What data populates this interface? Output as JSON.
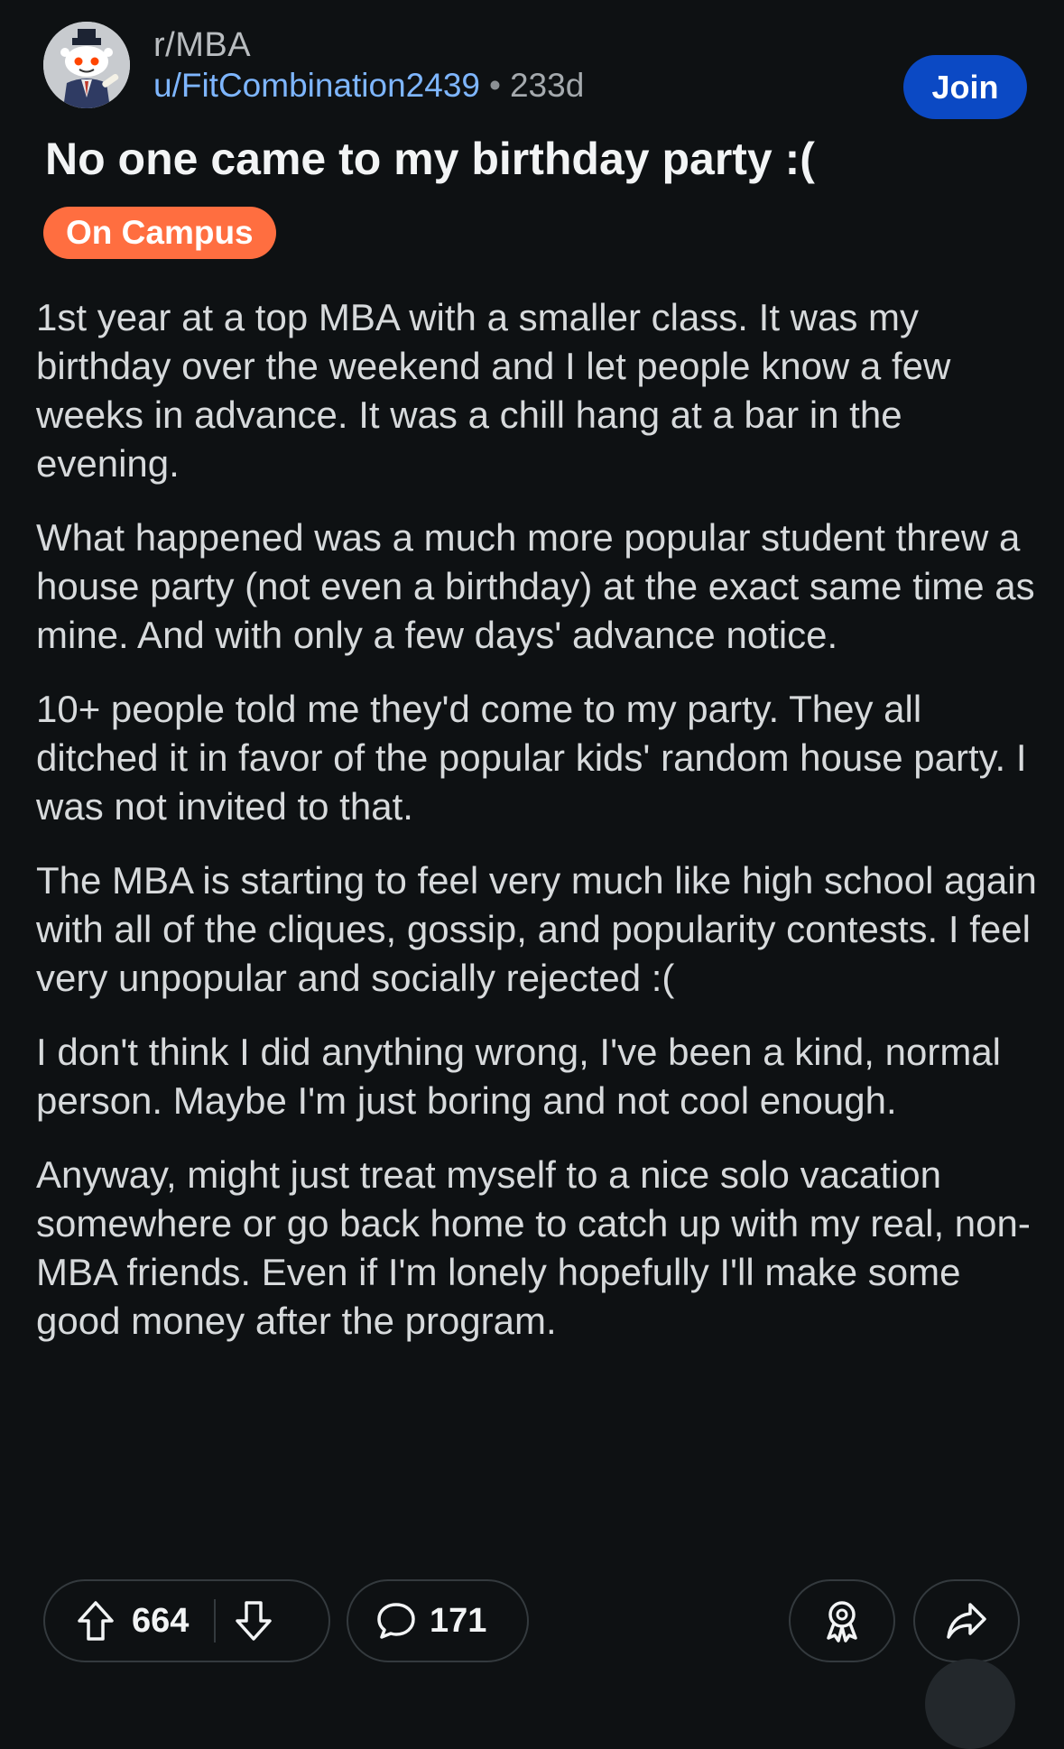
{
  "post": {
    "subreddit": "r/MBA",
    "username": "u/FitCombination2439",
    "separator": "•",
    "age": "233d",
    "join_label": "Join",
    "title": "No one came to my birthday party :(",
    "flair": "On Campus",
    "flair_color": "#ff6e40",
    "paragraphs": [
      "1st year at a top MBA with a smaller class. It was my birthday over the weekend and I let people know a few weeks in advance. It was a chill hang at a bar in the evening.",
      "What happened was a much more popular student threw a house party (not even a birthday) at the exact same time as mine. And with only a few days' advance notice.",
      "10+ people told me they'd come to my party. They all ditched it in favor of the popular kids' random house party. I was not invited to that.",
      "The MBA is starting to feel very much like high school again with all of the cliques, gossip, and popularity contests. I feel very unpopular and socially rejected :(",
      "I don't think I did anything wrong, I've been a kind, normal person. Maybe I'm just boring and not cool enough.",
      "Anyway, might just treat myself to a nice solo vacation somewhere or go back home to catch up with my real, non-MBA friends. Even if I'm lonely hopefully I'll make some good money after the program."
    ]
  },
  "actions": {
    "upvotes": "664",
    "comments": "171",
    "icons": [
      "upvote-icon",
      "downvote-icon",
      "comment-icon",
      "award-icon",
      "share-icon"
    ]
  },
  "colors": {
    "background": "#0e1113",
    "join_button": "#0b49c4",
    "username": "#7eb6ff"
  }
}
